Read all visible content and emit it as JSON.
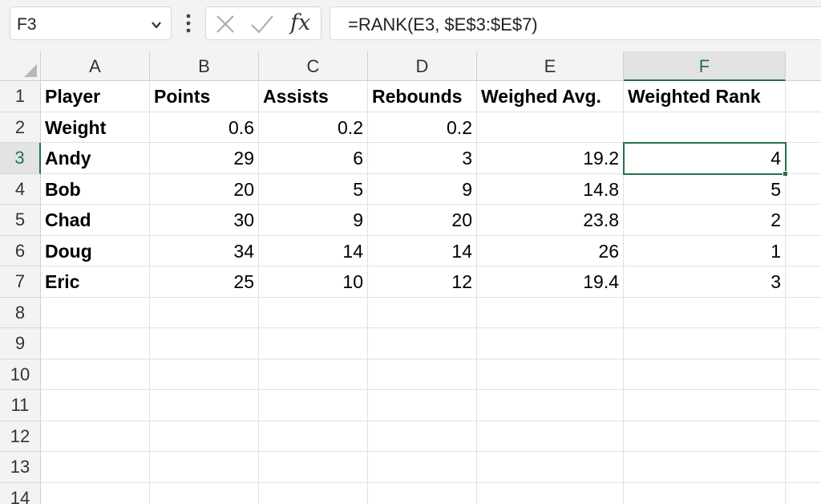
{
  "formula_bar": {
    "name_box": "F3",
    "formula": "=RANK(E3, $E$3:$E$7)"
  },
  "columns": [
    "A",
    "B",
    "C",
    "D",
    "E",
    "F"
  ],
  "selected_column": "F",
  "selected_row": "3",
  "rows": [
    {
      "num": "1",
      "cells": [
        "Player",
        "Points",
        "Assists",
        "Rebounds",
        "Weighed Avg.",
        "Weighted Rank"
      ]
    },
    {
      "num": "2",
      "cells": [
        "Weight",
        "0.6",
        "0.2",
        "0.2",
        "",
        ""
      ]
    },
    {
      "num": "3",
      "cells": [
        "Andy",
        "29",
        "6",
        "3",
        "19.2",
        "4"
      ]
    },
    {
      "num": "4",
      "cells": [
        "Bob",
        "20",
        "5",
        "9",
        "14.8",
        "5"
      ]
    },
    {
      "num": "5",
      "cells": [
        "Chad",
        "30",
        "9",
        "20",
        "23.8",
        "2"
      ]
    },
    {
      "num": "6",
      "cells": [
        "Doug",
        "34",
        "14",
        "14",
        "26",
        "1"
      ]
    },
    {
      "num": "7",
      "cells": [
        "Eric",
        "25",
        "10",
        "12",
        "19.4",
        "3"
      ]
    },
    {
      "num": "8",
      "cells": [
        "",
        "",
        "",
        "",
        "",
        ""
      ]
    },
    {
      "num": "9",
      "cells": [
        "",
        "",
        "",
        "",
        "",
        ""
      ]
    },
    {
      "num": "10",
      "cells": [
        "",
        "",
        "",
        "",
        "",
        ""
      ]
    },
    {
      "num": "11",
      "cells": [
        "",
        "",
        "",
        "",
        "",
        ""
      ]
    },
    {
      "num": "12",
      "cells": [
        "",
        "",
        "",
        "",
        "",
        ""
      ]
    },
    {
      "num": "13",
      "cells": [
        "",
        "",
        "",
        "",
        "",
        ""
      ]
    },
    {
      "num": "14",
      "cells": [
        "",
        "",
        "",
        "",
        "",
        ""
      ]
    }
  ],
  "icons": {
    "name_box_dropdown": "chevron-down-icon",
    "more": "vertical-dots-icon",
    "cancel": "close-icon",
    "enter": "checkmark-icon",
    "insert_function": "fx-icon"
  },
  "colors": {
    "accent": "#217346",
    "header_bg": "#f3f3f3",
    "gridline": "#e1e1e1"
  }
}
